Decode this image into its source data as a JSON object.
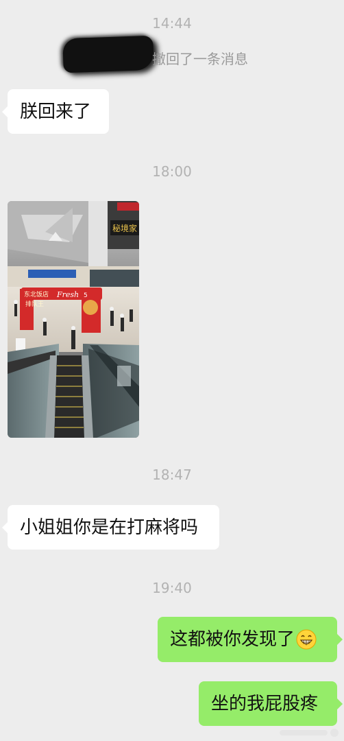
{
  "chat": {
    "timestamps": {
      "t1": "14:44",
      "t2": "18:00",
      "t3": "18:47",
      "t4": "19:40"
    },
    "recall_notice": "撤回了一条消息",
    "messages": {
      "m1": "朕回来了",
      "m2": "小姐姐你是在打麻将吗",
      "m3": "这都被你发现了",
      "m4": "坐的我屁股疼"
    },
    "photo": {
      "sign_top": "秘境家",
      "arch_text_1": "东北饭店",
      "arch_text_2": "排队王",
      "arch_brand": "Fresh",
      "arch_side": "5"
    },
    "emoji_name": "grinning-face",
    "colors": {
      "background": "#ededed",
      "bubble_left": "#ffffff",
      "bubble_right": "#95ec69",
      "timestamp": "#b2b2b2"
    }
  }
}
